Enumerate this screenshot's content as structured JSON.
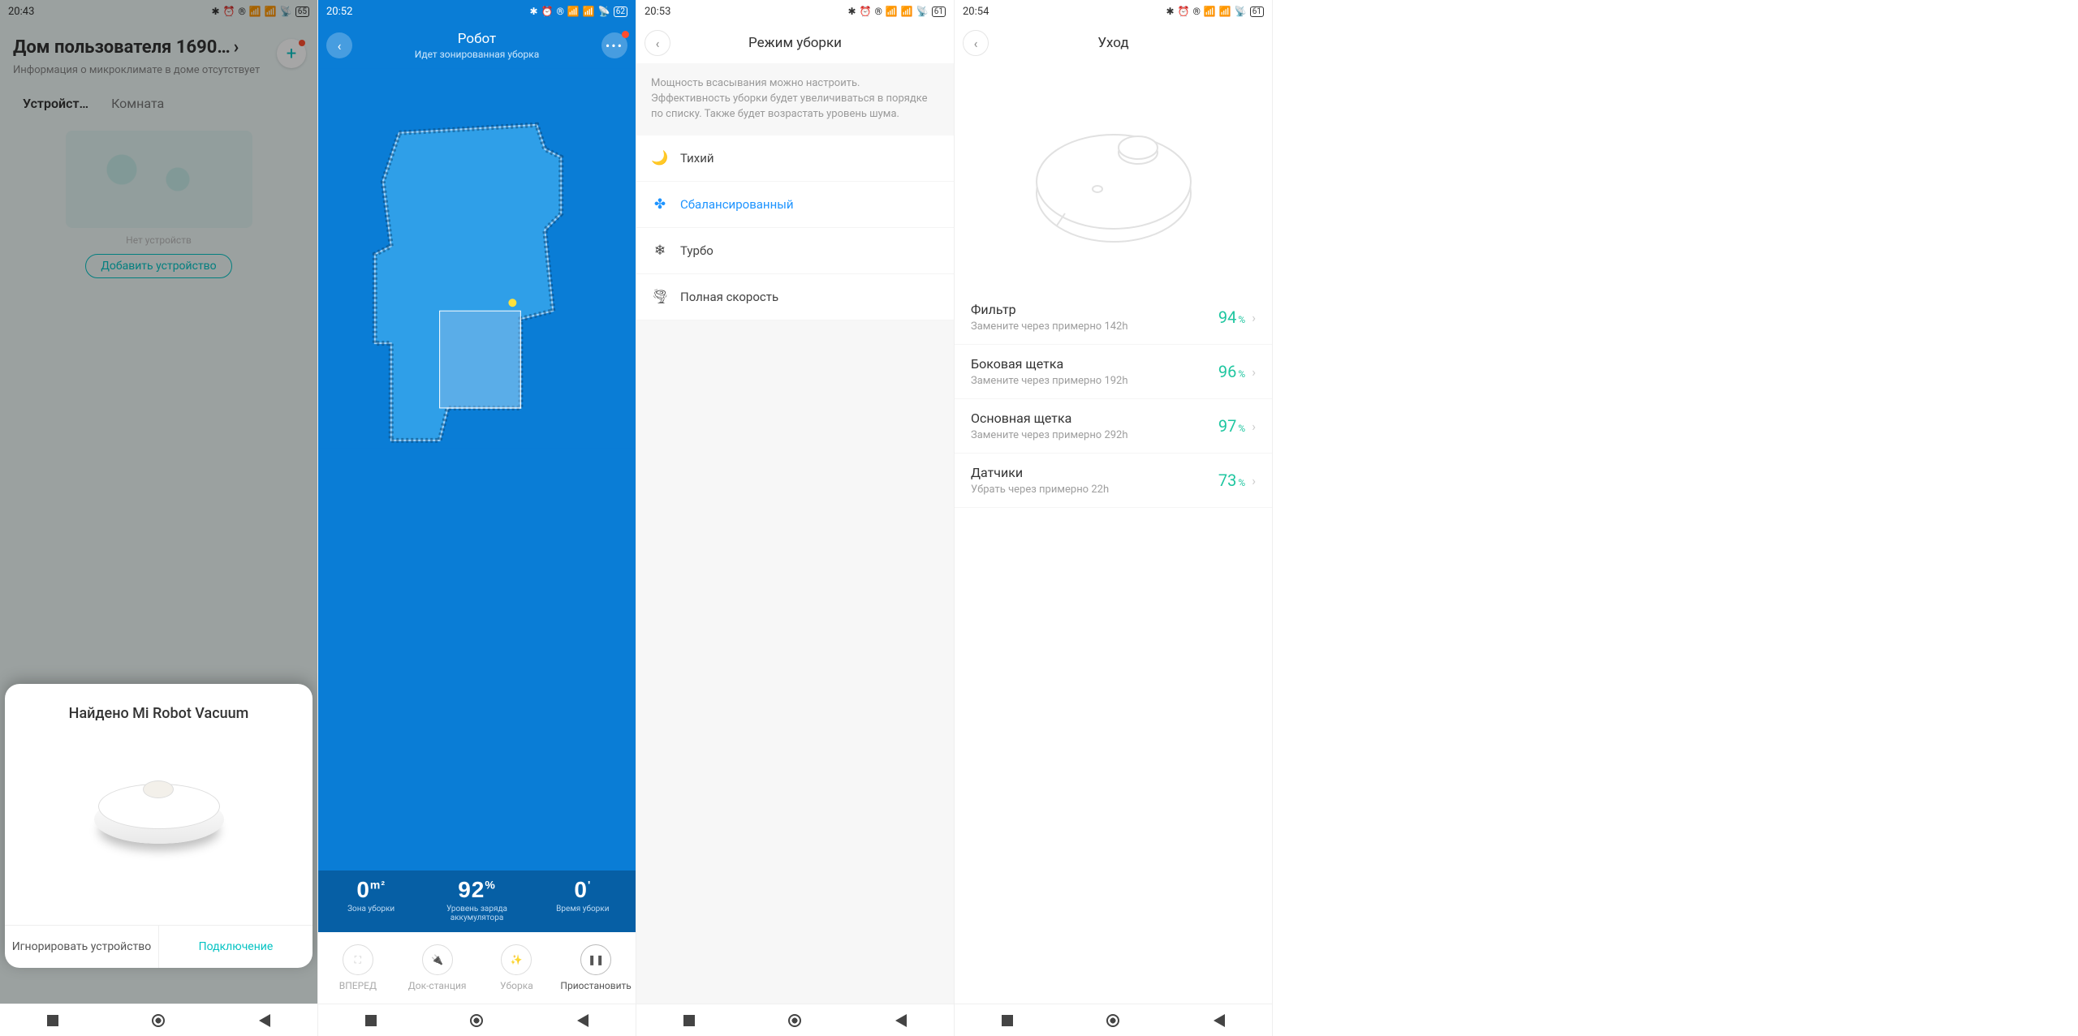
{
  "screens": {
    "s1": {
      "time": "20:43",
      "battery": "65",
      "title": "Дом пользователя 1690…",
      "subtitle": "Информация о микроклимате в доме отсутствует",
      "tabs": {
        "devices": "Устройст…",
        "room": "Комната"
      },
      "no_device": "Нет устройств",
      "add_device": "Добавить устройство",
      "sheet": {
        "title": "Найдено Mi Robot Vacuum",
        "ignore": "Игнорировать устройство",
        "connect": "Подключение"
      }
    },
    "s2": {
      "time": "20:52",
      "battery": "62",
      "title": "Робот",
      "subtitle": "Идет зонированная уборка",
      "stats": {
        "area_unit": "m²",
        "area_val": "0",
        "area_label": "Зона уборки",
        "batt_val": "92",
        "batt_unit": "%",
        "batt_label": "Уровень заряда аккумулятора",
        "time_val": "0",
        "time_unit": "'",
        "time_label": "Время уборки"
      },
      "actions": {
        "forward": "ВПЕРЕД",
        "dock": "Док-станция",
        "clean": "Уборка",
        "pause": "Приостановить"
      }
    },
    "s3": {
      "time": "20:53",
      "battery": "61",
      "title": "Режим уборки",
      "desc": "Мощность всасывания можно настроить. Эффективность уборки будет увеличиваться в порядке по списку. Также будет возрастать уровень шума.",
      "modes": {
        "quiet": "Тихий",
        "balanced": "Сбалансированный",
        "turbo": "Турбо",
        "full": "Полная скорость"
      }
    },
    "s4": {
      "time": "20:54",
      "battery": "61",
      "title": "Уход",
      "items": [
        {
          "name": "Фильтр",
          "hint": "Замените через примерно 142h",
          "pct": "94"
        },
        {
          "name": "Боковая щетка",
          "hint": "Замените через примерно 192h",
          "pct": "96"
        },
        {
          "name": "Основная щетка",
          "hint": "Замените через примерно 292h",
          "pct": "97"
        },
        {
          "name": "Датчики",
          "hint": "Убрать через примерно 22h",
          "pct": "73"
        }
      ]
    }
  }
}
